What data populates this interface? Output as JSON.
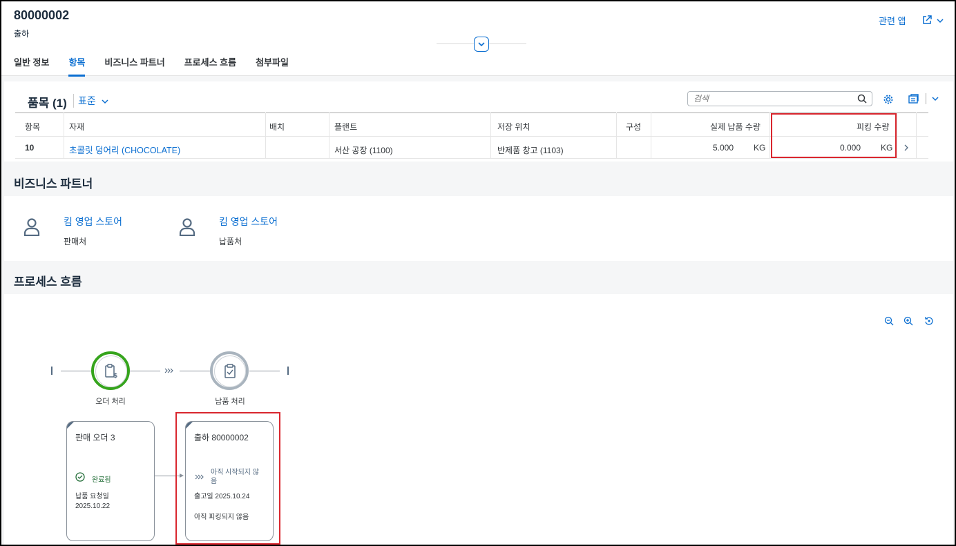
{
  "header": {
    "title": "80000002",
    "subtitle": "출하",
    "related_apps": "관련 앱",
    "tabs": [
      "일반 정보",
      "항목",
      "비즈니스 파트너",
      "프로세스 흐름",
      "첨부파일"
    ],
    "active_tab": "항목"
  },
  "items": {
    "title": "품목 (1)",
    "variant": "표준",
    "search_placeholder": "검색",
    "columns": [
      "항목",
      "자재",
      "배치",
      "플랜트",
      "저장 위치",
      "구성",
      "실제 납품 수량",
      "피킹 수량"
    ],
    "row": {
      "item": "10",
      "material": "초콜릿 덩어리 (CHOCOLATE)",
      "batch": "",
      "plant": "서산 공장 (1100)",
      "storage": "반제품 창고 (1103)",
      "structure": "",
      "delivered_qty": "5.000",
      "delivered_unit": "KG",
      "picked_qty": "0.000",
      "picked_unit": "KG"
    }
  },
  "business_partner": {
    "title": "비즈니스 파트너",
    "partners": [
      {
        "name": "킴 영업 스토어",
        "role": "판매처"
      },
      {
        "name": "킴 영업 스토어",
        "role": "납품처"
      }
    ]
  },
  "process_flow": {
    "title": "프로세스 흐름",
    "lanes": [
      {
        "label": "오더 처리",
        "color": "#36a41d"
      },
      {
        "label": "납품 처리",
        "color": "#a9b4be"
      }
    ],
    "cards": [
      {
        "title": "판매 오더 3",
        "status": "완료됨",
        "status_color": "#256f3a",
        "meta1": "납품 요청일",
        "meta2": "2025.10.22"
      },
      {
        "title": "출하 80000002",
        "status": "아직 시작되지 않음",
        "meta1": "출고일 2025.10.24",
        "meta2": "아직 피킹되지 않음"
      }
    ]
  },
  "colors": {
    "accent": "#0a6ed1",
    "highlight": "#d9262e",
    "success": "#36a41d"
  }
}
